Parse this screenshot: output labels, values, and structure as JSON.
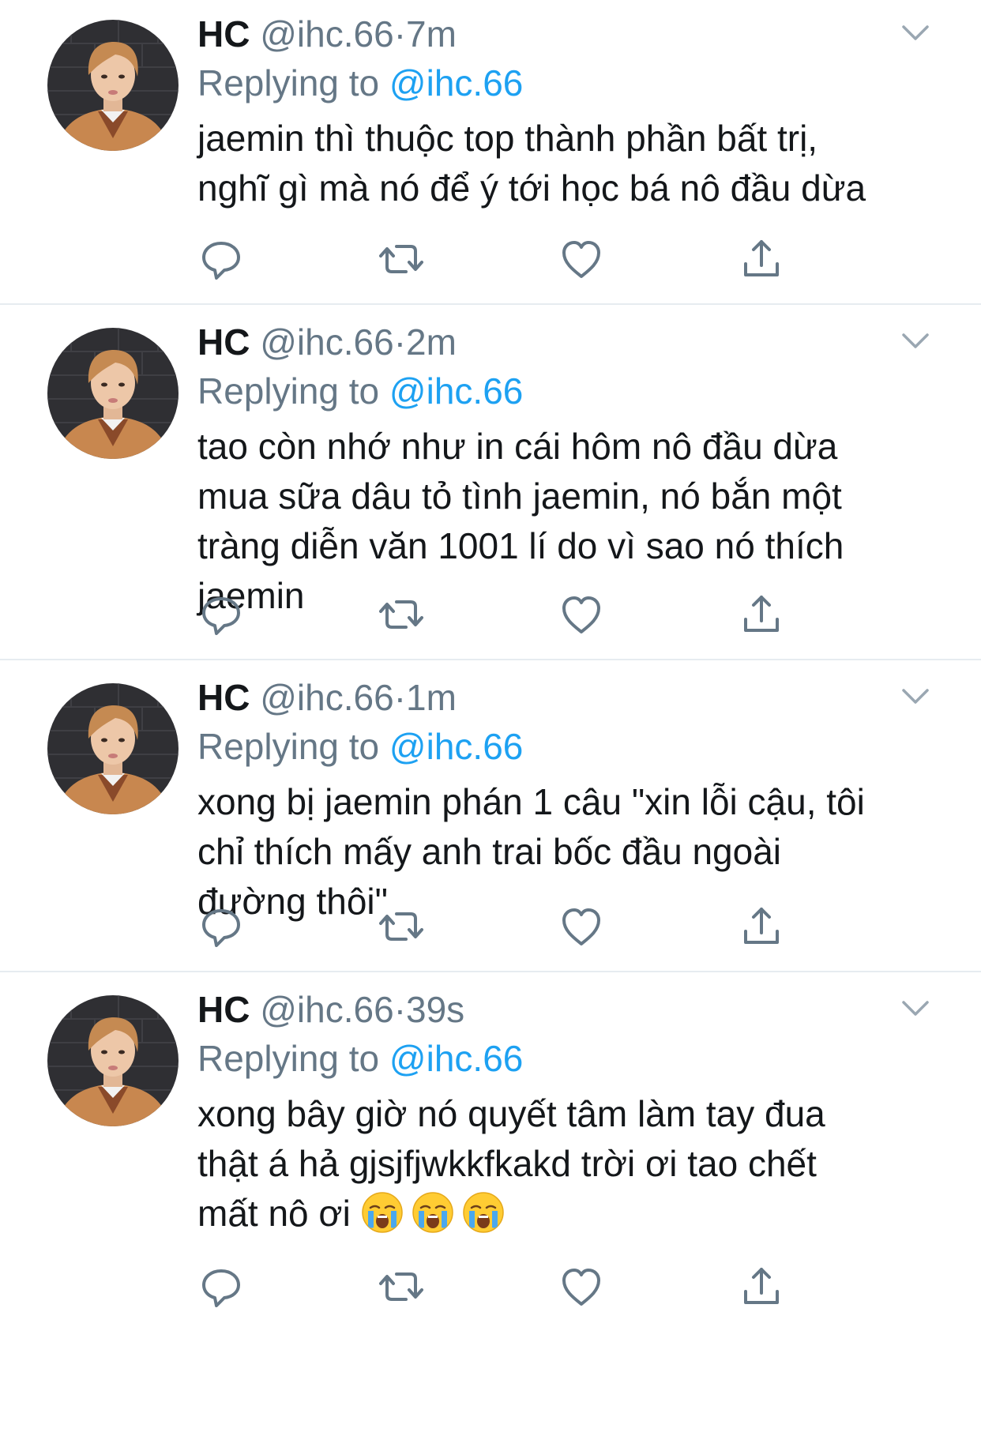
{
  "tweets": [
    {
      "name": "HC",
      "handle": "@ihc.66",
      "separator": "·",
      "time": "7m",
      "replying_prefix": "Replying to",
      "replying_to": "@ihc.66",
      "lines": [
        "jaemin thì thuộc top thành phần bất trị,",
        "nghĩ gì mà nó để ý tới học bá nô đầu dừa"
      ]
    },
    {
      "name": "HC",
      "handle": "@ihc.66",
      "separator": "·",
      "time": "2m",
      "replying_prefix": "Replying to",
      "replying_to": "@ihc.66",
      "lines": [
        "tao còn nhớ như in cái hôm nô đầu dừa",
        "mua sữa dâu tỏ tình jaemin, nó bắn một",
        "tràng diễn văn 1001 lí do vì sao nó thích",
        "jaemin"
      ]
    },
    {
      "name": "HC",
      "handle": "@ihc.66",
      "separator": "·",
      "time": "1m",
      "replying_prefix": "Replying to",
      "replying_to": "@ihc.66",
      "lines": [
        "xong bị jaemin phán 1 câu \"xin lỗi cậu, tôi",
        "chỉ thích mấy anh trai bốc đầu ngoài",
        "đường thôi\""
      ]
    },
    {
      "name": "HC",
      "handle": "@ihc.66",
      "separator": "·",
      "time": "39s",
      "replying_prefix": "Replying to",
      "replying_to": "@ihc.66",
      "lines": [
        "xong bây giờ nó quyết tâm làm tay đua",
        "thật á hả gjsjfjwkkfkakd trời ơi tao chết",
        "mất nô ơi"
      ],
      "emojis": [
        "loudly-crying-face",
        "loudly-crying-face",
        "loudly-crying-face"
      ]
    }
  ],
  "icons": {
    "reply": "reply-icon",
    "retweet": "retweet-icon",
    "like": "like-heart-icon",
    "share": "share-icon",
    "menu": "chevron-down-icon"
  },
  "colors": {
    "text": "#14171a",
    "secondary": "#657786",
    "mention": "#1da1f2",
    "divider": "#e6ecf0"
  }
}
